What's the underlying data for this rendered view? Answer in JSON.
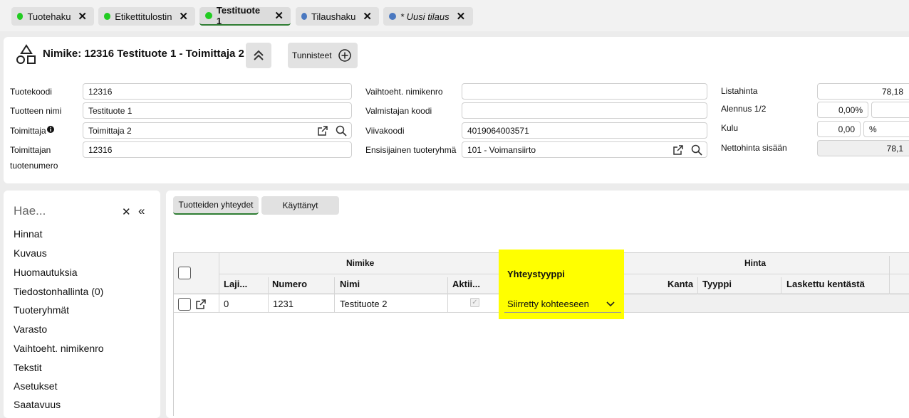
{
  "tabs": [
    {
      "label": "Tuotehaku",
      "dot": "#22cc22",
      "italic": false,
      "active": false
    },
    {
      "label": "Etikettitulostin",
      "dot": "#22cc22",
      "italic": false,
      "active": false
    },
    {
      "label": "Testituote 1",
      "dot": "#22cc22",
      "italic": false,
      "active": true
    },
    {
      "label": "Tilaushaku",
      "dot": "#4a78c0",
      "italic": false,
      "active": false
    },
    {
      "label": "* Uusi tilaus",
      "dot": "#4a78c0",
      "italic": true,
      "active": false
    }
  ],
  "header": {
    "title": "Nimike: 12316 Testituote 1 - Toimittaja 2",
    "tunnisteet_label": "Tunnisteet"
  },
  "form": {
    "tuotekoodi_label": "Tuotekoodi",
    "tuotekoodi_value": "12316",
    "tuotteen_nimi_label": "Tuotteen nimi",
    "tuotteen_nimi_value": "Testituote 1",
    "toimittaja_label": "Toimittaja",
    "toimittaja_value": "Toimittaja 2",
    "toimittajan_tuotenumero_label_1": "Toimittajan",
    "toimittajan_tuotenumero_label_2": "tuotenumero",
    "toimittajan_tuotenumero_value": "12316",
    "vaihtoeht_label": "Vaihtoeht. nimikenro",
    "vaihtoeht_value": "",
    "valmistajan_koodi_label": "Valmistajan koodi",
    "valmistajan_koodi_value": "",
    "viivakoodi_label": "Viivakoodi",
    "viivakoodi_value": "4019064003571",
    "tuoteryhma_label": "Ensisijainen tuoteryhmä",
    "tuoteryhma_value": "101 - Voimansiirto",
    "listahinta_label": "Listahinta",
    "listahinta_value": "78,18",
    "alennus_label": "Alennus 1/2",
    "alennus_value": "0,00%",
    "kulu_label": "Kulu",
    "kulu_value": "0,00",
    "kulu_unit": "%",
    "nettohinta_label": "Nettohinta sisään",
    "nettohinta_value": "78,1"
  },
  "sidebar": {
    "search_placeholder": "Hae...",
    "items": [
      "Hinnat",
      "Kuvaus",
      "Huomautuksia",
      "Tiedostonhallinta (0)",
      "Tuoteryhmät",
      "Varasto",
      "Vaihtoeht. nimikenro",
      "Tekstit",
      "Asetukset",
      "Saatavuus"
    ]
  },
  "subtabs": [
    "Tuotteiden yhteydet",
    "Käyttänyt"
  ],
  "grid": {
    "group_nimike": "Nimike",
    "group_yhteystyyppi": "Yhteystyyppi",
    "group_hinta": "Hinta",
    "col_laji": "Laji...",
    "col_numero": "Numero",
    "col_nimi": "Nimi",
    "col_aktii": "Aktii...",
    "col_kanta": "Kanta",
    "col_tyyppi": "Tyyppi",
    "col_laskettu": "Laskettu kentästä",
    "rows": [
      {
        "laji": "0",
        "numero": "1231",
        "nimi": "Testituote 2",
        "aktiivinen": true,
        "yhteystyyppi": "Siirretty kohteeseen"
      }
    ]
  },
  "colors": {
    "highlight": "#ffff00",
    "active_tab_underline": "#2e7d32"
  }
}
